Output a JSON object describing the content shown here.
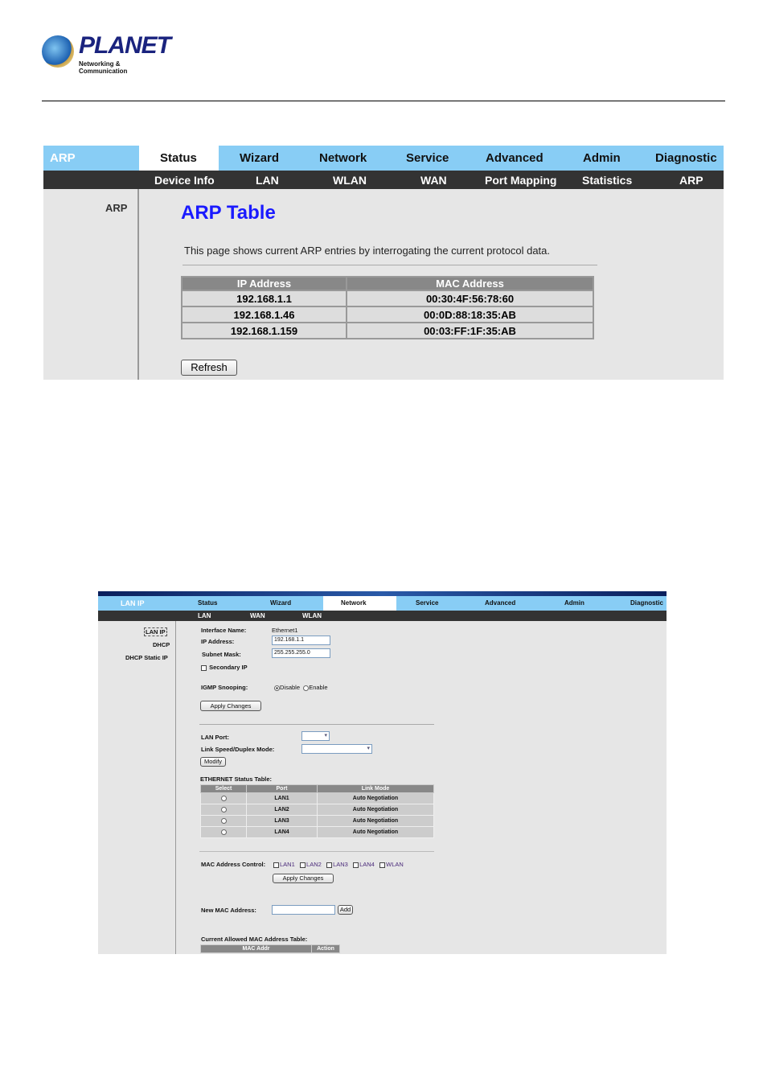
{
  "logo": {
    "brand": "PLANET",
    "tagline": "Networking & Communication"
  },
  "shot1": {
    "section": "ARP",
    "tabs": [
      "Status",
      "Wizard",
      "Network",
      "Service",
      "Advanced",
      "Admin",
      "Diagnostic"
    ],
    "active_tab": "Status",
    "subtabs": [
      "Device Info",
      "LAN",
      "WLAN",
      "WAN",
      "Port Mapping",
      "Statistics",
      "ARP"
    ],
    "side_item": "ARP",
    "title": "ARP Table",
    "description": "This page shows current ARP entries by interrogating the current protocol data.",
    "table": {
      "headers": [
        "IP Address",
        "MAC Address"
      ],
      "rows": [
        [
          "192.168.1.1",
          "00:30:4F:56:78:60"
        ],
        [
          "192.168.1.46",
          "00:0D:88:18:35:AB"
        ],
        [
          "192.168.1.159",
          "00:03:FF:1F:35:AB"
        ]
      ]
    },
    "refresh": "Refresh"
  },
  "shot2": {
    "section": "LAN IP",
    "tabs": [
      "Status",
      "Wizard",
      "Network",
      "Service",
      "Advanced",
      "Admin",
      "Diagnostic"
    ],
    "active_tab": "Network",
    "subtabs": [
      "LAN",
      "WAN",
      "WLAN"
    ],
    "side_items": [
      "LAN IP",
      "DHCP",
      "DHCP Static IP"
    ],
    "interface_label": "Interface Name:",
    "interface_value": "Ethernet1",
    "ip_label": "IP Address:",
    "ip_value": "192.168.1.1",
    "mask_label": "Subnet Mask:",
    "mask_value": "255.255.255.0",
    "secondary_ip": "Secondary IP",
    "igmp_label": "IGMP Snooping:",
    "igmp_options": [
      "Disable",
      "Enable"
    ],
    "apply": "Apply Changes",
    "lan_port_label": "LAN Port:",
    "link_mode_label": "Link Speed/Duplex Mode:",
    "modify": "Modify",
    "eth_table_title": "ETHERNET Status Table:",
    "eth_table": {
      "headers": [
        "Select",
        "Port",
        "Link Mode"
      ],
      "rows": [
        [
          "LAN1",
          "Auto Negotiation"
        ],
        [
          "LAN2",
          "Auto Negotiation"
        ],
        [
          "LAN3",
          "Auto Negotiation"
        ],
        [
          "LAN4",
          "Auto Negotiation"
        ]
      ]
    },
    "mac_control_label": "MAC Address Control:",
    "mac_control_options": [
      "LAN1",
      "LAN2",
      "LAN3",
      "LAN4",
      "WLAN"
    ],
    "new_mac_label": "New MAC Address:",
    "add": "Add",
    "allowed_table_title": "Current Allowed MAC Address Table:",
    "allowed_headers": [
      "MAC Addr",
      "Action"
    ]
  }
}
